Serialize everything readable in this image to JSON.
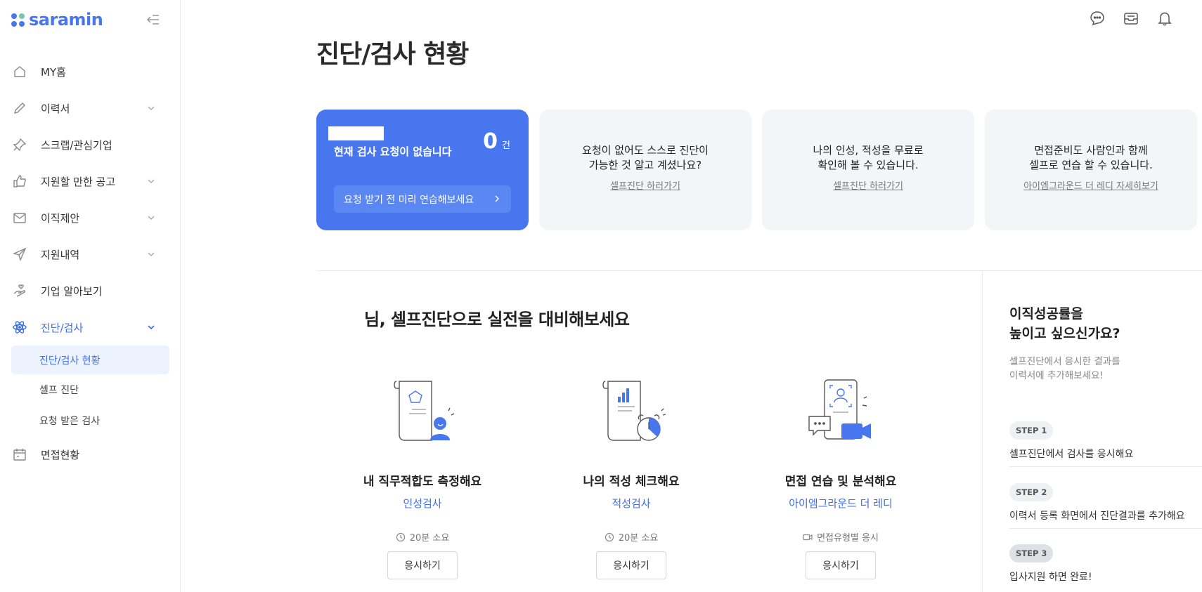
{
  "logo": {
    "text": "saramin",
    "dot_colors": [
      "#4876ef",
      "#6ec8b4",
      "#4876ef",
      "#4876ef"
    ]
  },
  "sidebar": {
    "items": [
      {
        "label": "MY홈",
        "icon": "home-icon",
        "expandable": false
      },
      {
        "label": "이력서",
        "icon": "pencil-icon",
        "expandable": true
      },
      {
        "label": "스크랩/관심기업",
        "icon": "pin-icon",
        "expandable": false
      },
      {
        "label": "지원할 만한 공고",
        "icon": "thumbs-up-icon",
        "expandable": true
      },
      {
        "label": "이직제안",
        "icon": "envelope-icon",
        "expandable": true
      },
      {
        "label": "지원내역",
        "icon": "paper-plane-icon",
        "expandable": true
      },
      {
        "label": "기업 알아보기",
        "icon": "hand-heart-icon",
        "expandable": false
      },
      {
        "label": "진단/검사",
        "icon": "atom-icon",
        "expandable": true,
        "active": true
      },
      {
        "label": "면접현황",
        "icon": "calendar-icon",
        "expandable": false
      }
    ],
    "sub_items": [
      {
        "label": "진단/검사 현황",
        "active": true
      },
      {
        "label": "셀프 진단"
      },
      {
        "label": "요청 받은 검사"
      }
    ]
  },
  "top_icons": [
    "chat-icon",
    "inbox-icon",
    "bell-icon"
  ],
  "page_title": "진단/검사 현황",
  "cards": {
    "request": {
      "status_text": "현재 검사 요청이 없습니다",
      "count": "0",
      "count_unit": "건",
      "button_label": "요청 받기 전 미리 연습해보세요"
    },
    "info": [
      {
        "line1": "요청이 없어도 스스로 진단이",
        "line2": "가능한 것 알고 계셨나요?",
        "link": "셀프진단 하러가기"
      },
      {
        "line1": "나의 인성, 적성을 무료로",
        "line2": "확인해 볼 수 있습니다.",
        "link": "셀프진단 하러가기"
      },
      {
        "line1": "면접준비도 사람인과 함께",
        "line2": "셀프로 연습 할 수 있습니다.",
        "link": "아이엠그라운드 더 레디 자세히보기"
      }
    ]
  },
  "section_title": "님, 셀프진단으로 실전을 대비해보세요",
  "features": [
    {
      "name": "내 직무적합도 측정해요",
      "type": "인성검사",
      "meta": "20분 소요",
      "meta_icon": "clock-icon",
      "button": "응시하기",
      "illustration": "personality-test-illustration"
    },
    {
      "name": "나의 적성 체크해요",
      "type": "적성검사",
      "meta": "20분 소요",
      "meta_icon": "clock-icon",
      "button": "응시하기",
      "illustration": "aptitude-test-illustration"
    },
    {
      "name": "면접 연습 및 분석해요",
      "type": "아이엠그라운드 더 레디",
      "meta": "면접유형별 응시",
      "meta_icon": "video-icon",
      "button": "응시하기",
      "illustration": "interview-practice-illustration"
    }
  ],
  "right_panel": {
    "title_line1": "이직성공률을",
    "title_line2": "높이고 싶으신가요?",
    "desc_line1": "셀프진단에서 응시한 결과를",
    "desc_line2": "이력서에 추가해보세요!",
    "steps": [
      {
        "badge": "STEP 1",
        "text": "셀프진단에서 검사를 응시해요"
      },
      {
        "badge": "STEP 2",
        "text": "이력서 등록 화면에서 진단결과를 추가해요"
      },
      {
        "badge": "STEP 3",
        "text": "입사지원 하면 완료!"
      }
    ]
  },
  "colors": {
    "accent": "#4876ef",
    "accent_text": "#3d6ee8",
    "card_bg": "#f4f5f8"
  }
}
